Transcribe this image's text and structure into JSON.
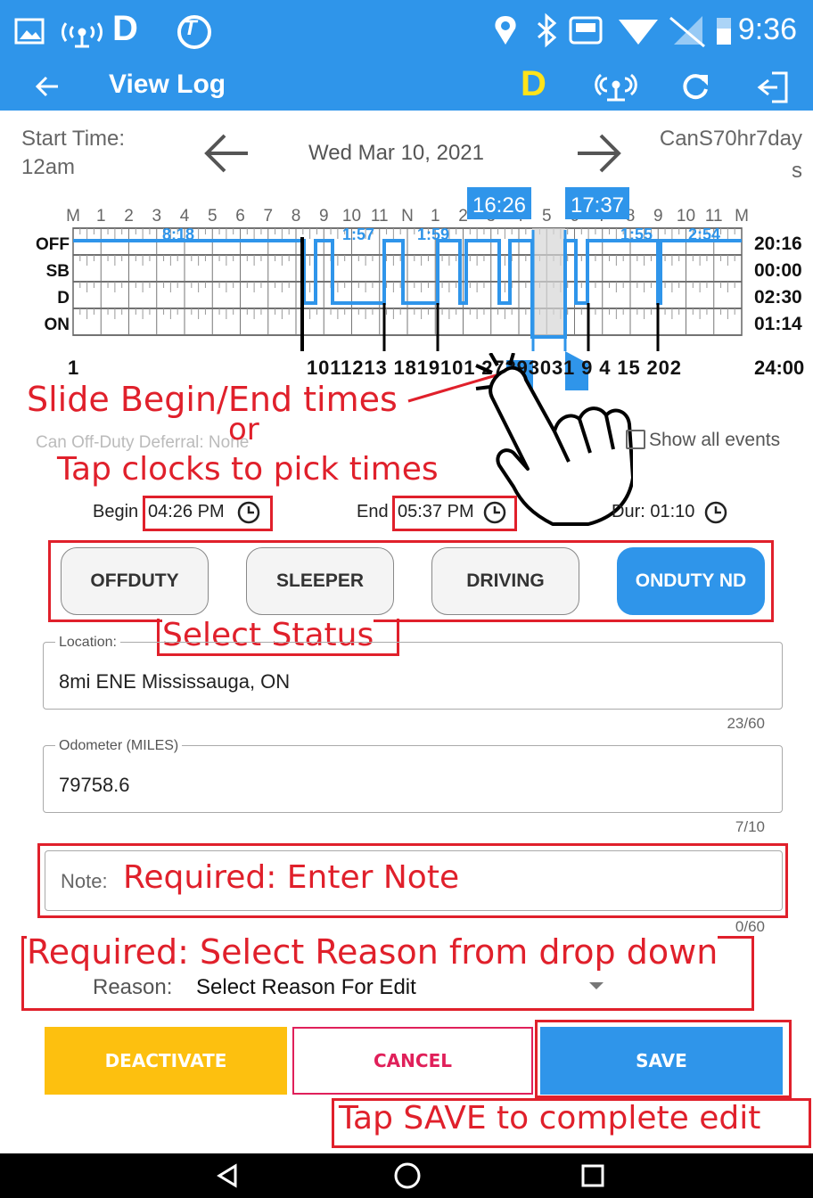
{
  "statusbar": {
    "time": "9:36",
    "d_label": "D",
    "t_label": "T"
  },
  "appbar": {
    "title": "View Log",
    "d_label": "D"
  },
  "header": {
    "start_time_label": "Start Time:",
    "start_time_value": "12am",
    "date": "Wed Mar 10, 2021",
    "ruleset_line1": "CanS70hr7day",
    "ruleset_line2": "s"
  },
  "chart": {
    "hour_labels": [
      "M",
      "1",
      "2",
      "3",
      "4",
      "5",
      "6",
      "7",
      "8",
      "9",
      "10",
      "11",
      "N",
      "1",
      "2",
      "3",
      "4",
      "5",
      "6",
      "7",
      "8",
      "9",
      "10",
      "11",
      "M"
    ],
    "row_labels": [
      "OFF",
      "SB",
      "D",
      "ON"
    ],
    "totals": [
      "20:16",
      "00:00",
      "02:30",
      "01:14"
    ],
    "total_all": "24:00",
    "bottom_start": "1",
    "bottom_markers": "1011213   1819101   27293031   9  4  15   202",
    "segment_labels": [
      "8:18",
      "1:57",
      "1:59",
      "1:55",
      "2:54"
    ],
    "begin_handle": "16:26",
    "end_handle": "17:37"
  },
  "annotations": {
    "slide": "Slide Begin/End times",
    "or": "or",
    "tap_clocks": "Tap clocks to pick times",
    "select_status": "Select Status",
    "required_note": "Required: Enter Note",
    "required_reason": "Required: Select Reason from drop down",
    "tap_save": "Tap SAVE to complete edit"
  },
  "deferral": {
    "text": "Can Off-Duty Deferral: None"
  },
  "show_all_events": "Show all events",
  "times": {
    "begin_label": "Begin",
    "begin_value": "04:26 PM",
    "end_label": "End",
    "end_value": "05:37 PM",
    "dur_label": "Dur: 01:10"
  },
  "status_buttons": [
    {
      "label": "OFFDUTY",
      "active": false
    },
    {
      "label": "SLEEPER",
      "active": false
    },
    {
      "label": "DRIVING",
      "active": false
    },
    {
      "label": "ONDUTY ND",
      "active": true
    }
  ],
  "location": {
    "label": "Location:",
    "value": "8mi ENE Mississauga, ON",
    "counter": "23/60"
  },
  "odometer": {
    "label": "Odometer (MILES)",
    "value": "79758.6",
    "counter": "7/10"
  },
  "note": {
    "label": "Note:",
    "counter": "0/60"
  },
  "reason": {
    "label": "Reason:",
    "value": "Select Reason For Edit"
  },
  "buttons": {
    "deactivate": "DEACTIVATE",
    "cancel": "CANCEL",
    "save": "SAVE"
  },
  "colors": {
    "accent": "#2f95ea",
    "annotation": "#e0202b",
    "deactivate": "#fdc00f",
    "cancel_text": "#e0205a"
  }
}
